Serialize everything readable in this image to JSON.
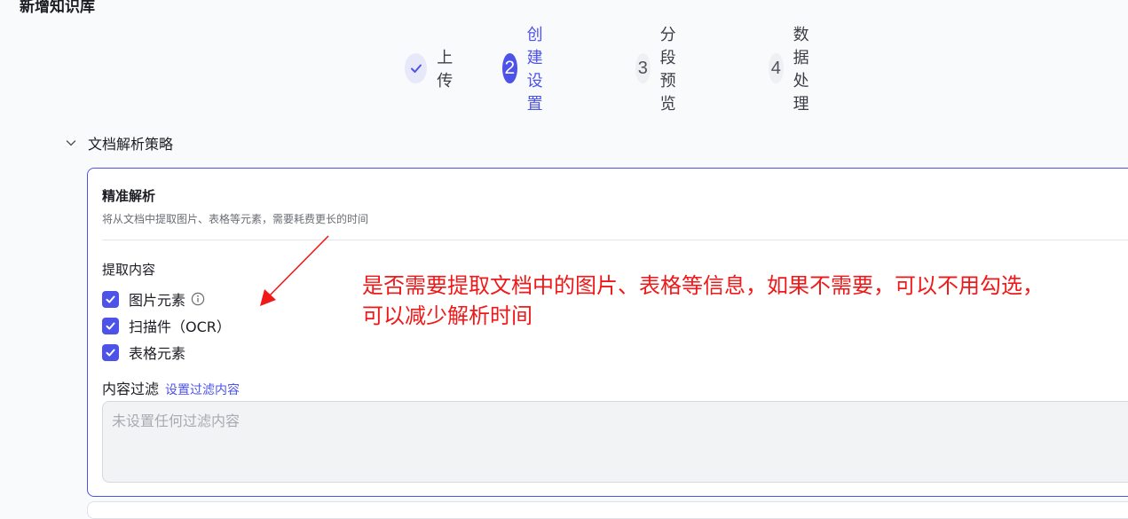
{
  "page": {
    "title": "新增知识库"
  },
  "steps": [
    {
      "number": "",
      "label": "上传",
      "state": "done"
    },
    {
      "number": "2",
      "label": "创建设置",
      "state": "active"
    },
    {
      "number": "3",
      "label": "分段预览",
      "state": "todo"
    },
    {
      "number": "4",
      "label": "数据处理",
      "state": "todo"
    }
  ],
  "section": {
    "title": "文档解析策略"
  },
  "strategy": {
    "title": "精准解析",
    "description": "将从文档中提取图片、表格等元素，需要耗费更长的时间",
    "extract_label": "提取内容",
    "options": [
      {
        "label": "图片元素",
        "checked": true
      },
      {
        "label": "扫描件（OCR）",
        "checked": true
      },
      {
        "label": "表格元素",
        "checked": true
      }
    ],
    "filter_label": "内容过滤",
    "filter_link": "设置过滤内容",
    "filter_placeholder": "未设置任何过滤内容"
  },
  "annotation": {
    "line1": "是否需要提取文档中的图片、表格等信息，如果不需要，可以不用勾选，",
    "line2": "可以减少解析时间",
    "color": "#f01818"
  },
  "colors": {
    "accent": "#4d53e8"
  },
  "icons": [
    "check-icon",
    "chevron-down-icon",
    "info-icon",
    "arrow-icon"
  ]
}
